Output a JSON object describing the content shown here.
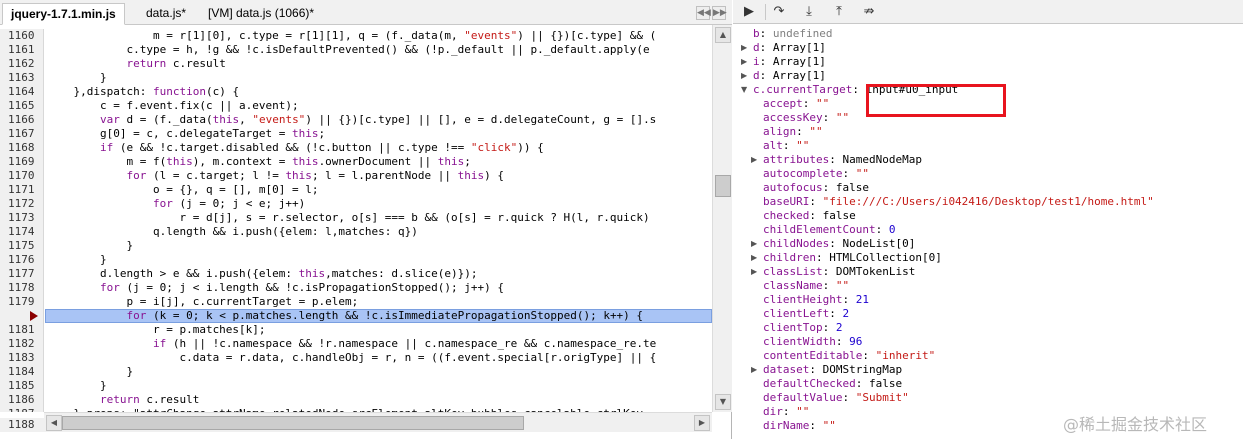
{
  "tabs": [
    {
      "label": "jquery-1.7.1.min.js",
      "active": true
    },
    {
      "label": "data.js*",
      "active": false
    },
    {
      "label": "[VM] data.js (1066)*",
      "active": false
    }
  ],
  "colors": {
    "highlight_line": "#a9c4f5",
    "breakpoint": "#8b0000",
    "red_box": "#e8141e"
  },
  "code": {
    "highlight_line": 1180,
    "lines": [
      {
        "n": "1160",
        "text": "                m = r[1][0], c.type = r[1][1], q = (f._data(m, \"events\") || {})[c.type] && ("
      },
      {
        "n": "1161",
        "text": "            c.type = h, !g && !c.isDefaultPrevented() && (!p._default || p._default.apply(e"
      },
      {
        "n": "1162",
        "text": "            return c.result"
      },
      {
        "n": "1163",
        "text": "        }"
      },
      {
        "n": "1164",
        "text": "    },dispatch: function(c) {"
      },
      {
        "n": "1165",
        "text": "        c = f.event.fix(c || a.event);"
      },
      {
        "n": "1166",
        "text": "        var d = (f._data(this, \"events\") || {})[c.type] || [], e = d.delegateCount, g = [].s"
      },
      {
        "n": "1167",
        "text": "        g[0] = c, c.delegateTarget = this;"
      },
      {
        "n": "1168",
        "text": "        if (e && !c.target.disabled && (!c.button || c.type !== \"click\")) {"
      },
      {
        "n": "1169",
        "text": "            m = f(this), m.context = this.ownerDocument || this;"
      },
      {
        "n": "1170",
        "text": "            for (l = c.target; l != this; l = l.parentNode || this) {"
      },
      {
        "n": "1171",
        "text": "                o = {}, q = [], m[0] = l;"
      },
      {
        "n": "1172",
        "text": "                for (j = 0; j < e; j++)"
      },
      {
        "n": "1173",
        "text": "                    r = d[j], s = r.selector, o[s] === b && (o[s] = r.quick ? H(l, r.quick)"
      },
      {
        "n": "1174",
        "text": "                q.length && i.push({elem: l,matches: q})"
      },
      {
        "n": "1175",
        "text": "            }"
      },
      {
        "n": "1176",
        "text": "        }"
      },
      {
        "n": "1177",
        "text": "        d.length > e && i.push({elem: this,matches: d.slice(e)});"
      },
      {
        "n": "1178",
        "text": "        for (j = 0; j < i.length && !c.isPropagationStopped(); j++) {"
      },
      {
        "n": "1179",
        "text": "            p = i[j], c.currentTarget = p.elem;"
      },
      {
        "n": "",
        "text": "            for (k = 0; k < p.matches.length && !c.isImmediatePropagationStopped(); k++) {"
      },
      {
        "n": "1181",
        "text": "                r = p.matches[k];"
      },
      {
        "n": "1182",
        "text": "                if (h || !c.namespace && !r.namespace || c.namespace_re && c.namespace_re.te"
      },
      {
        "n": "1183",
        "text": "                    c.data = r.data, c.handleObj = r, n = ((f.event.special[r.origType] || {"
      },
      {
        "n": "1184",
        "text": "            }"
      },
      {
        "n": "1185",
        "text": "        }"
      },
      {
        "n": "1186",
        "text": "        return c.result"
      },
      {
        "n": "1187",
        "text": "    },props: \"attrChange attrName relatedNode srcElement altKey bubbles cancelable ctrlKey"
      }
    ],
    "last_gutter": "1188"
  },
  "props": [
    {
      "indent": 1,
      "tri": "",
      "name": "b",
      "value": "undefined",
      "vtype": "u"
    },
    {
      "indent": 1,
      "tri": "▶",
      "name": "d",
      "value": "Array[1]",
      "vtype": "k"
    },
    {
      "indent": 1,
      "tri": "▶",
      "name": "i",
      "value": "Array[1]",
      "vtype": "k"
    },
    {
      "indent": 1,
      "tri": "▶",
      "name": "d",
      "value": "Array[1]",
      "vtype": "k"
    },
    {
      "indent": 1,
      "tri": "▼",
      "name": "c.currentTarget",
      "value": "input#u0_input",
      "vtype": "k"
    },
    {
      "indent": 2,
      "tri": "",
      "name": "accept",
      "value": "\"\"",
      "vtype": "s"
    },
    {
      "indent": 2,
      "tri": "",
      "name": "accessKey",
      "value": "\"\"",
      "vtype": "s"
    },
    {
      "indent": 2,
      "tri": "",
      "name": "align",
      "value": "\"\"",
      "vtype": "s"
    },
    {
      "indent": 2,
      "tri": "",
      "name": "alt",
      "value": "\"\"",
      "vtype": "s"
    },
    {
      "indent": 2,
      "tri": "▶",
      "name": "attributes",
      "value": "NamedNodeMap",
      "vtype": "k"
    },
    {
      "indent": 2,
      "tri": "",
      "name": "autocomplete",
      "value": "\"\"",
      "vtype": "s"
    },
    {
      "indent": 2,
      "tri": "",
      "name": "autofocus",
      "value": "false",
      "vtype": "k"
    },
    {
      "indent": 2,
      "tri": "",
      "name": "baseURI",
      "value": "\"file:///C:/Users/i042416/Desktop/test1/home.html\"",
      "vtype": "s"
    },
    {
      "indent": 2,
      "tri": "",
      "name": "checked",
      "value": "false",
      "vtype": "k"
    },
    {
      "indent": 2,
      "tri": "",
      "name": "childElementCount",
      "value": "0",
      "vtype": "n"
    },
    {
      "indent": 2,
      "tri": "▶",
      "name": "childNodes",
      "value": "NodeList[0]",
      "vtype": "k"
    },
    {
      "indent": 2,
      "tri": "▶",
      "name": "children",
      "value": "HTMLCollection[0]",
      "vtype": "k"
    },
    {
      "indent": 2,
      "tri": "▶",
      "name": "classList",
      "value": "DOMTokenList",
      "vtype": "k"
    },
    {
      "indent": 2,
      "tri": "",
      "name": "className",
      "value": "\"\"",
      "vtype": "s"
    },
    {
      "indent": 2,
      "tri": "",
      "name": "clientHeight",
      "value": "21",
      "vtype": "n"
    },
    {
      "indent": 2,
      "tri": "",
      "name": "clientLeft",
      "value": "2",
      "vtype": "n"
    },
    {
      "indent": 2,
      "tri": "",
      "name": "clientTop",
      "value": "2",
      "vtype": "n"
    },
    {
      "indent": 2,
      "tri": "",
      "name": "clientWidth",
      "value": "96",
      "vtype": "n"
    },
    {
      "indent": 2,
      "tri": "",
      "name": "contentEditable",
      "value": "\"inherit\"",
      "vtype": "s"
    },
    {
      "indent": 2,
      "tri": "▶",
      "name": "dataset",
      "value": "DOMStringMap",
      "vtype": "k"
    },
    {
      "indent": 2,
      "tri": "",
      "name": "defaultChecked",
      "value": "false",
      "vtype": "k"
    },
    {
      "indent": 2,
      "tri": "",
      "name": "defaultValue",
      "value": "\"Submit\"",
      "vtype": "s"
    },
    {
      "indent": 2,
      "tri": "",
      "name": "dir",
      "value": "\"\"",
      "vtype": "s"
    },
    {
      "indent": 2,
      "tri": "",
      "name": "dirName",
      "value": "\"\"",
      "vtype": "s"
    }
  ],
  "toolbar": {
    "icons": [
      "pause-resume-icon",
      "step-over-icon",
      "step-into-icon",
      "step-out-icon",
      "deactivate-breakpoints-icon"
    ],
    "glyphs": [
      "▶",
      "↷",
      "⤓",
      "⤒",
      "⇏"
    ]
  },
  "watermark": "@稀土掘金技术社区"
}
